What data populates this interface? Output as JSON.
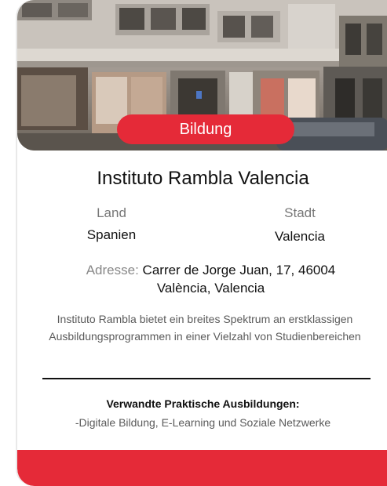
{
  "card": {
    "category_badge": "Bildung",
    "title": "Instituto Rambla Valencia",
    "country": {
      "label": "Land",
      "value": "Spanien"
    },
    "city": {
      "label": "Stadt",
      "value": "Valencia"
    },
    "address": {
      "label": "Adresse:",
      "value": "Carrer de Jorge Juan, 17, 46004 València, Valencia"
    },
    "description": "Instituto Rambla bietet ein breites Spektrum an erstklassigen Ausbildungsprogrammen in einer Vielzahl von Studienbereichen",
    "related": {
      "title": "Verwandte Praktische Ausbildungen:",
      "items": "-Digitale Bildung, E-Learning und Soziale Netzwerke"
    }
  },
  "colors": {
    "accent": "#e52a38",
    "text": "#111111",
    "muted": "#777777"
  }
}
